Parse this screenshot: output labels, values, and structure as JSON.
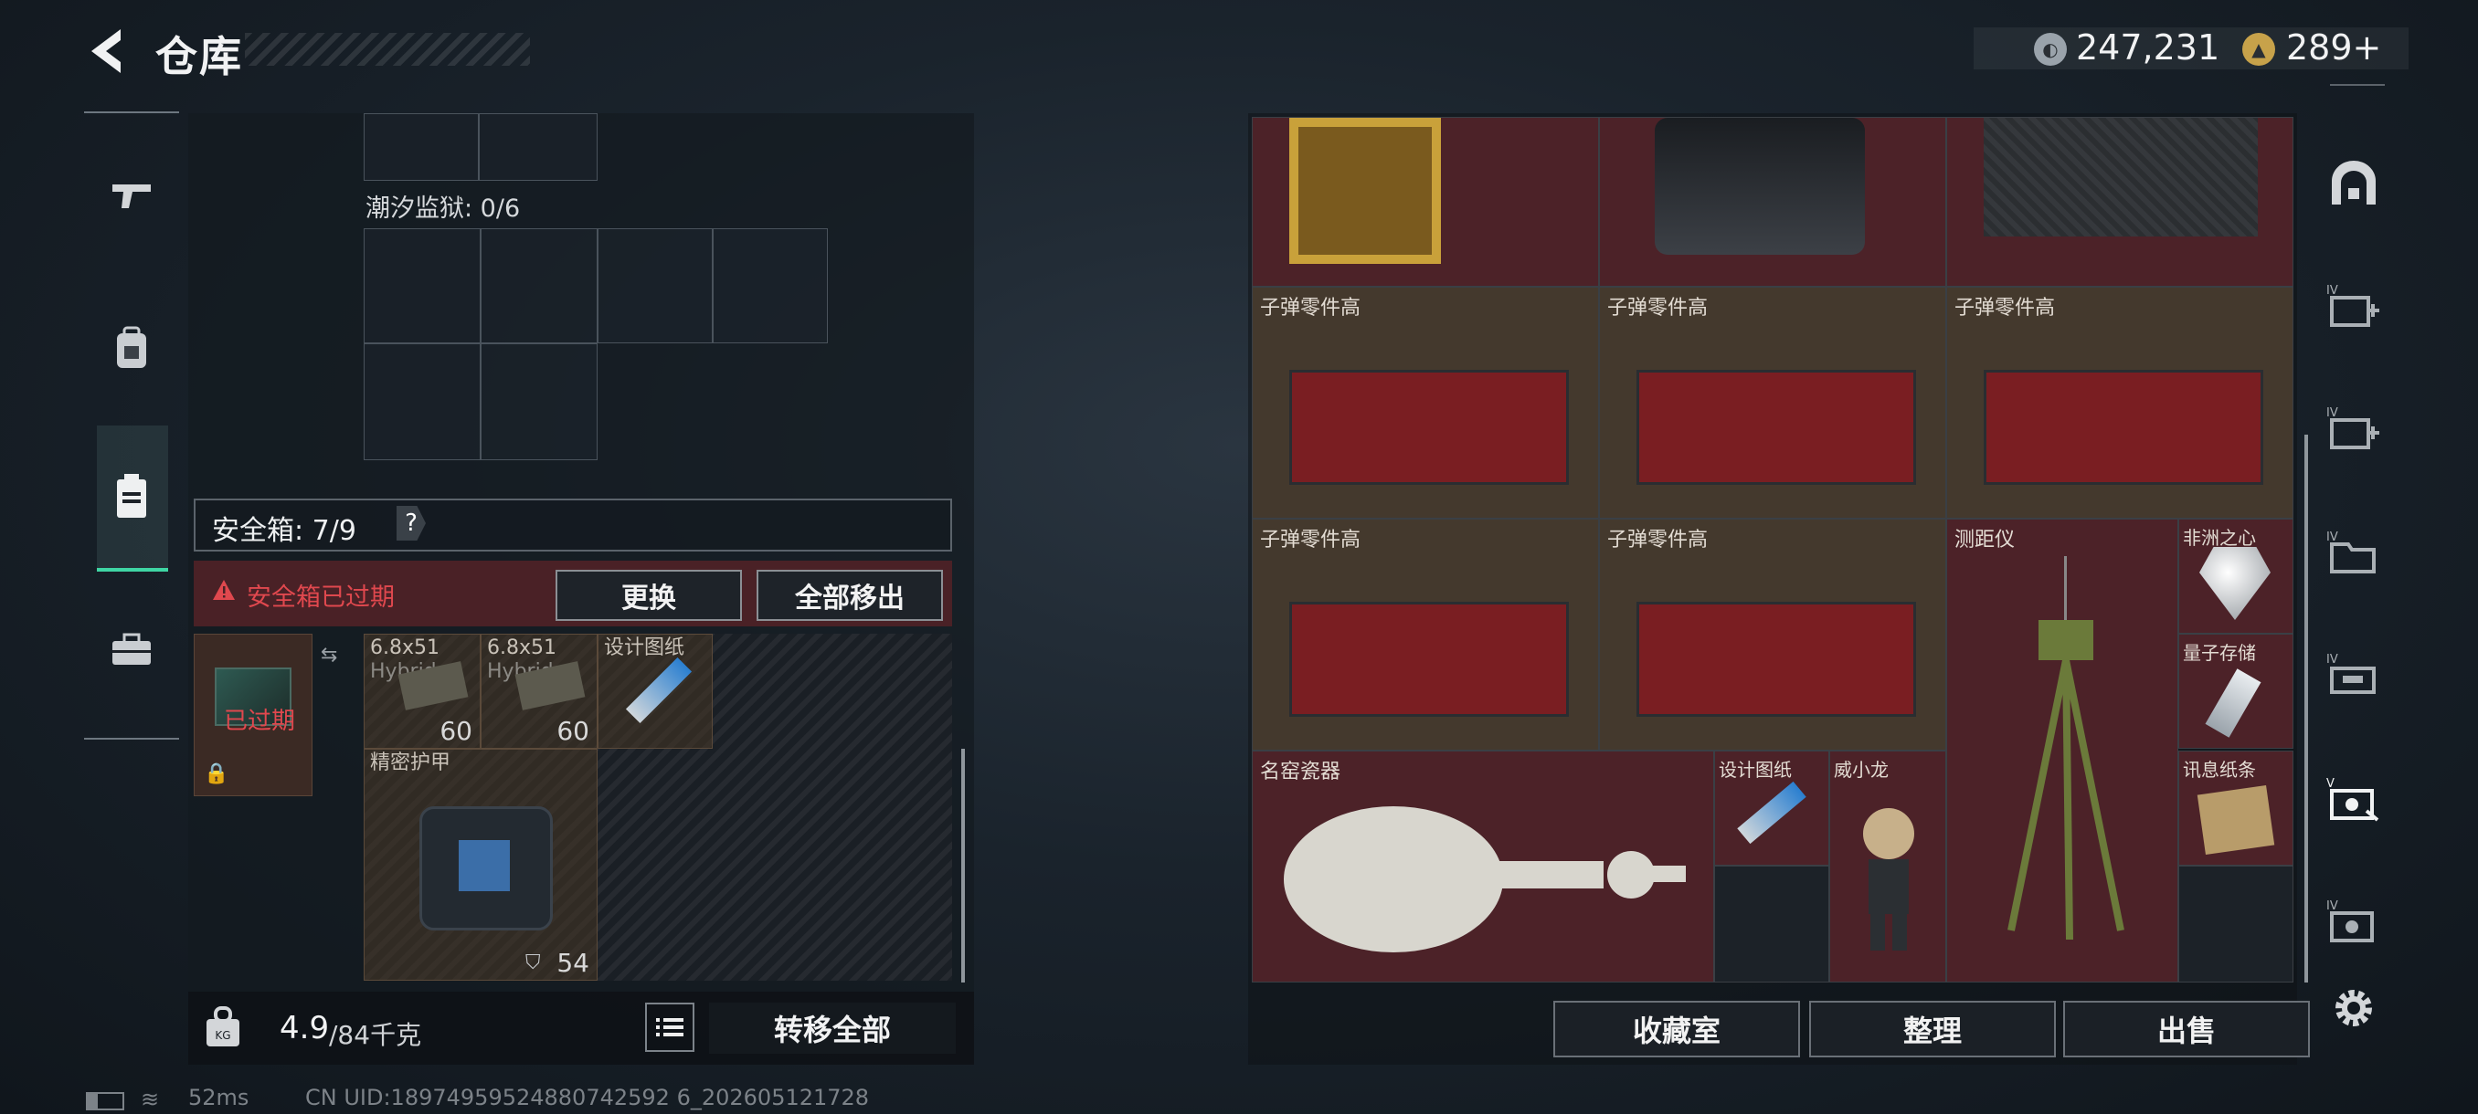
{
  "header": {
    "title": "仓库",
    "currency_1": "247,231",
    "currency_2": "289+"
  },
  "left": {
    "prison_label": "潮汐监狱: 0/6",
    "safebox_label": "安全箱: 7/9",
    "safebox_help": "?",
    "expired_msg": "安全箱已过期",
    "replace_btn": "更换",
    "moveall_btn": "全部移出",
    "case_expired": "已过期",
    "items": [
      {
        "name": "6.8x51",
        "sub": "Hybrid",
        "count": "60"
      },
      {
        "name": "6.8x51",
        "sub": "Hybrid",
        "count": "60"
      },
      {
        "name": "设计图纸"
      },
      {
        "name": "精密护甲",
        "count": "54"
      }
    ],
    "weight_value": "4.9",
    "weight_cap": "/84千克",
    "transfer_all": "转移全部"
  },
  "right": {
    "cells": [
      "子弹零件高",
      "子弹零件高",
      "子弹零件高",
      "子弹零件高",
      "子弹零件高",
      "测距仪",
      "非洲之心",
      "量子存储",
      "名窑瓷器",
      "设计图纸",
      "威小龙",
      "讯息纸条"
    ],
    "buttons": {
      "collection": "收藏室",
      "sort": "整理",
      "sell": "出售"
    }
  },
  "status": {
    "ping": "52ms",
    "uid": "CN UID:18974959524880742592 6_202605121728"
  },
  "colors": {
    "accent": "#3fd6a4",
    "expired_red": "#e0484e"
  }
}
